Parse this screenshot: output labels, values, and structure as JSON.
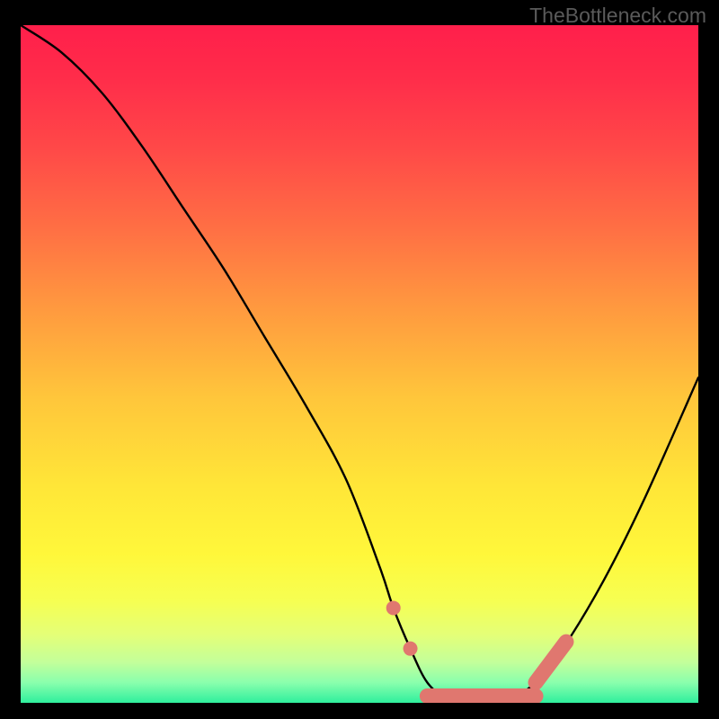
{
  "watermark": "TheBottleneck.com",
  "chart_data": {
    "type": "line",
    "title": "",
    "xlabel": "",
    "ylabel": "",
    "ylim": [
      0,
      100
    ],
    "xlim": [
      0,
      100
    ],
    "series": [
      {
        "name": "bottleneck-curve",
        "x": [
          0,
          6,
          12,
          18,
          24,
          30,
          36,
          42,
          48,
          53,
          55,
          57.5,
          60,
          63,
          66,
          68,
          72,
          76,
          80,
          86,
          92,
          100
        ],
        "values": [
          100,
          96,
          90,
          82,
          73,
          64,
          54,
          44,
          33,
          20,
          14,
          8,
          3,
          0.5,
          0,
          0,
          0.5,
          3,
          8,
          18,
          30,
          48
        ]
      }
    ],
    "annotations": [
      {
        "name": "marker-dot-left-upper",
        "x": 55.0,
        "y": 14.0,
        "type": "dot",
        "color": "#e0776f"
      },
      {
        "name": "marker-dot-left-lower",
        "x": 57.5,
        "y": 8.0,
        "type": "dot",
        "color": "#e0776f"
      },
      {
        "name": "marker-band-bottom",
        "x0": 60.0,
        "x1": 76.0,
        "y": 1.0,
        "type": "band",
        "color": "#e0776f"
      },
      {
        "name": "marker-band-right",
        "x0": 76.0,
        "x1": 80.5,
        "y0": 3.0,
        "y1": 9.0,
        "type": "segment",
        "color": "#e0776f"
      }
    ],
    "background_gradient": {
      "stops": [
        {
          "pos": 0.0,
          "color": "#ff1f4b"
        },
        {
          "pos": 0.08,
          "color": "#ff2d4a"
        },
        {
          "pos": 0.18,
          "color": "#ff4848"
        },
        {
          "pos": 0.3,
          "color": "#ff6f44"
        },
        {
          "pos": 0.42,
          "color": "#ff9a3f"
        },
        {
          "pos": 0.55,
          "color": "#ffc63b"
        },
        {
          "pos": 0.68,
          "color": "#ffe638"
        },
        {
          "pos": 0.78,
          "color": "#fff73a"
        },
        {
          "pos": 0.85,
          "color": "#f6ff52"
        },
        {
          "pos": 0.9,
          "color": "#e4ff78"
        },
        {
          "pos": 0.94,
          "color": "#c3ff9a"
        },
        {
          "pos": 0.97,
          "color": "#8affad"
        },
        {
          "pos": 1.0,
          "color": "#2fef9d"
        }
      ]
    }
  }
}
